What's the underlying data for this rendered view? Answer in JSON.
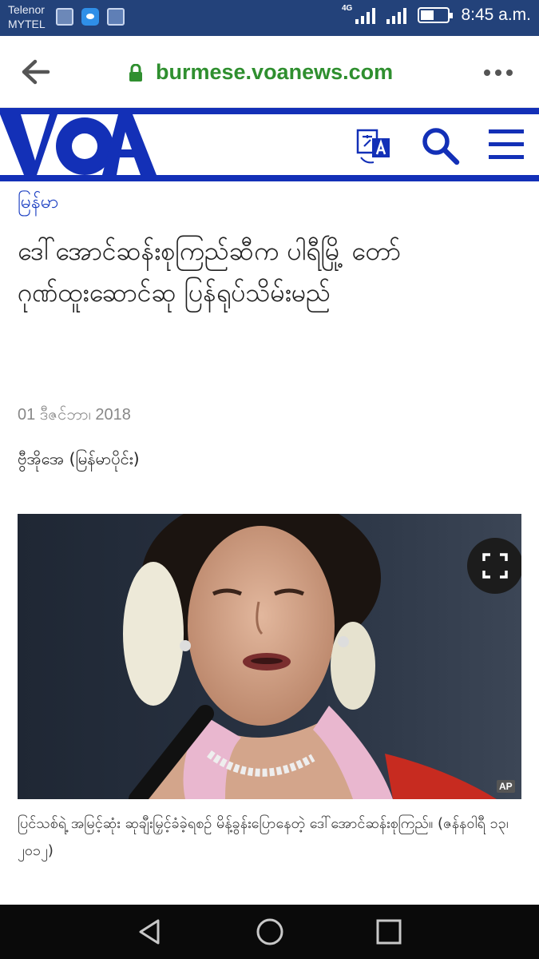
{
  "status_bar": {
    "carrier_line1": "Telenor",
    "carrier_line2": "MYTEL",
    "network": "4G",
    "time": "8:45 a.m.",
    "icons": [
      "gallery-icon",
      "messenger-icon",
      "photo-icon",
      "signal-icon",
      "battery-icon"
    ]
  },
  "browser": {
    "url": "burmese.voanews.com",
    "secure": true,
    "accent": "#2f8f2f"
  },
  "header": {
    "logo": "VOA",
    "brand_color": "#1330b7",
    "icons": [
      "translate-icon",
      "search-icon",
      "menu-icon"
    ]
  },
  "article": {
    "section": "မြန်မာ",
    "headline": "ဒေါ်အောင်ဆန်းစုကြည်ဆီက ပါရီမြို့ တော်ဂုဏ်ထူးဆောင်ဆု ပြန်ရုပ်သိမ်းမည်",
    "date": "01 ဒီဇင်ဘာ၊ 2018",
    "byline": "ဗွီအိုအေ (မြန်မာပိုင်း)",
    "photo_credit": "AP",
    "caption": "ပြင်သစ်ရဲ့ အမြင့်ဆုံး ဆုချီးမြှင့်ခံခဲ့ရစဉ် မိန့်ခွန်းပြောနေတဲ့ ဒေါ်အောင်ဆန်းစုကြည်။ (ဇန်နဝါရီ ၁၃၊ ၂၀၁၂)"
  },
  "nav": {
    "buttons": [
      "back-triangle-icon",
      "home-circle-icon",
      "recents-square-icon"
    ]
  }
}
